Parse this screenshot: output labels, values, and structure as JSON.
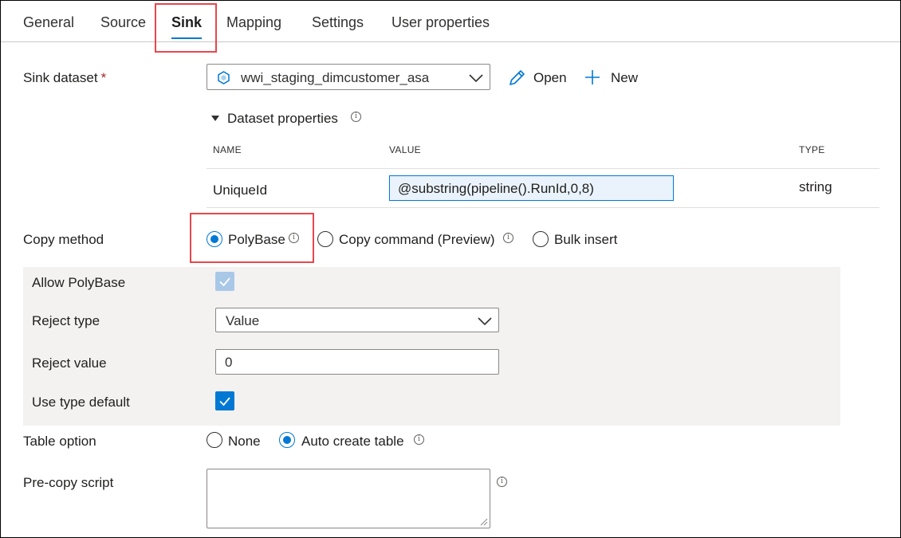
{
  "tabs": [
    {
      "label": "General"
    },
    {
      "label": "Source"
    },
    {
      "label": "Sink",
      "active": true
    },
    {
      "label": "Mapping"
    },
    {
      "label": "Settings"
    },
    {
      "label": "User properties"
    }
  ],
  "sink_dataset": {
    "label": "Sink dataset",
    "required_marker": "*",
    "selected": "wwi_staging_dimcustomer_asa",
    "dataset_icon": "dataset-hex-icon",
    "open_label": "Open",
    "new_label": "New"
  },
  "dataset_properties": {
    "title": "Dataset properties",
    "columns": {
      "name": "NAME",
      "value": "VALUE",
      "type": "TYPE"
    },
    "rows": [
      {
        "name": "UniqueId",
        "value": "@substring(pipeline().RunId,0,8)",
        "type": "string"
      }
    ]
  },
  "copy_method": {
    "label": "Copy method",
    "options": [
      "PolyBase",
      "Copy command (Preview)",
      "Bulk insert"
    ],
    "selected": "PolyBase"
  },
  "polybase": {
    "allow_label": "Allow PolyBase",
    "allow_checked": true,
    "reject_type_label": "Reject type",
    "reject_type_value": "Value",
    "reject_value_label": "Reject value",
    "reject_value": "0",
    "use_type_default_label": "Use type default",
    "use_type_default_checked": true
  },
  "table_option": {
    "label": "Table option",
    "options": [
      "None",
      "Auto create table"
    ],
    "selected": "Auto create table"
  },
  "pre_copy_script": {
    "label": "Pre-copy script",
    "value": ""
  },
  "colors": {
    "accent": "#0078d4",
    "highlight": "#e8474c",
    "panel": "#f3f2f1",
    "required": "#a4262c"
  }
}
